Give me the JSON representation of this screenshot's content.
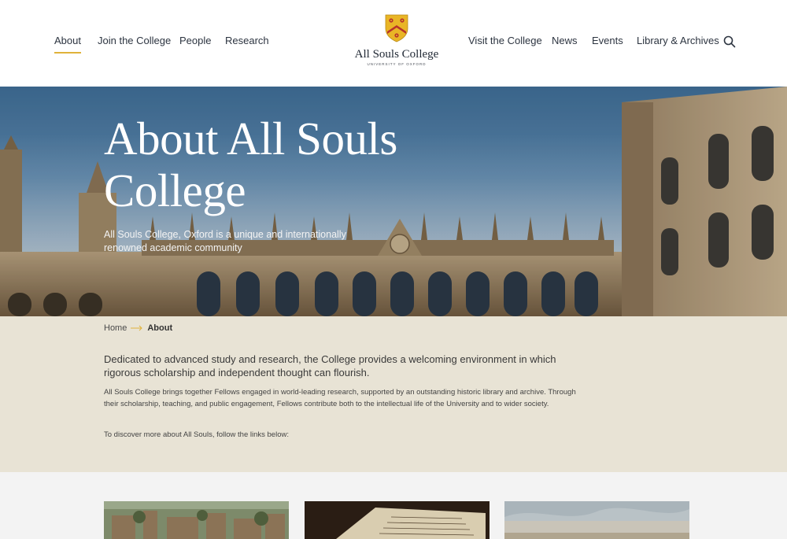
{
  "header": {
    "nav_left": [
      {
        "label": "About",
        "active": true
      },
      {
        "label": "Join the College",
        "active": false
      },
      {
        "label": "People",
        "active": false
      },
      {
        "label": "Research",
        "active": false
      }
    ],
    "nav_right": [
      {
        "label": "Visit the College"
      },
      {
        "label": "News"
      },
      {
        "label": "Events"
      },
      {
        "label": "Library & Archives"
      }
    ],
    "logo": {
      "title": "All Souls College",
      "subtitle": "UNIVERSITY OF OXFORD"
    },
    "search_icon": "search-icon"
  },
  "hero": {
    "title": "About All Souls College",
    "subtitle": "All Souls College, Oxford is a unique and internationally renowned academic community"
  },
  "breadcrumb": {
    "home": "Home",
    "current": "About"
  },
  "intro": {
    "lead": "Dedicated to advanced study and research, the College provides a welcoming environment in which rigorous scholarship and independent thought can flourish.",
    "body": "All Souls College brings together Fellows engaged in world-leading research, supported by an outstanding historic library and archive. Through their scholarship, teaching, and public engagement, Fellows contribute both to the intellectual life of the University and to wider society.",
    "body2": "To discover more about All Souls, follow the links below:"
  },
  "colors": {
    "accent": "#e0b23a",
    "intro_bg": "#e8e3d5",
    "cards_bg": "#f3f3f3",
    "text": "#2c3440"
  }
}
